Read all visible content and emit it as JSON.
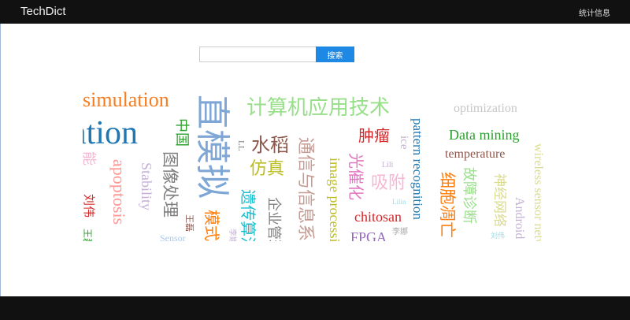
{
  "header": {
    "brand": "TechDict",
    "nav_stats": "统计信息"
  },
  "search": {
    "value": "",
    "placeholder": "",
    "button_label": "搜索"
  },
  "word_cloud": {
    "words": [
      {
        "text": "simulation",
        "color": "#f57c1f"
      },
      {
        "text": "ation",
        "color": "#1f77b4"
      },
      {
        "text": "直模拟",
        "color": "#7fa7d6"
      },
      {
        "text": "计算机应用技术",
        "color": "#98df8a"
      },
      {
        "text": "optimization",
        "color": "#c7c7c7"
      },
      {
        "text": "中国",
        "color": "#2ca02c"
      },
      {
        "text": "水稻",
        "color": "#8c564b"
      },
      {
        "text": "肿瘤",
        "color": "#d62728"
      },
      {
        "text": "pattern recognition",
        "color": "#1f77b4"
      },
      {
        "text": "Data mining",
        "color": "#2ca02c"
      },
      {
        "text": "temperature",
        "color": "#8c564b"
      },
      {
        "text": "wireless sensor networks",
        "color": "#dbdb8d"
      },
      {
        "text": "能",
        "color": "#f7b6d2"
      },
      {
        "text": "apoptosis",
        "color": "#ff9896"
      },
      {
        "text": "Stability",
        "color": "#c5b0d5"
      },
      {
        "text": "图像处理",
        "color": "#7f7f7f"
      },
      {
        "text": "仿真",
        "color": "#bcbd22"
      },
      {
        "text": "通信与信息系统",
        "color": "#c49c94"
      },
      {
        "text": "image processing",
        "color": "#bcbd22"
      },
      {
        "text": "光催化",
        "color": "#e377c2"
      },
      {
        "text": "吸附",
        "color": "#f7b6d2"
      },
      {
        "text": "ice",
        "color": "#c5b0d5"
      },
      {
        "text": "细胞凋亡",
        "color": "#ff7f0e"
      },
      {
        "text": "故障诊断",
        "color": "#98df8a"
      },
      {
        "text": "神经网络",
        "color": "#dbdb8d"
      },
      {
        "text": "Android",
        "color": "#c5b0d5"
      },
      {
        "text": "遗传算法",
        "color": "#17becf"
      },
      {
        "text": "企业管理",
        "color": "#7f7f7f"
      },
      {
        "text": "模式",
        "color": "#ff7f0e"
      },
      {
        "text": "chitosan",
        "color": "#d62728"
      },
      {
        "text": "FPGA",
        "color": "#9467bd"
      },
      {
        "text": "Sensor",
        "color": "#aec7e8"
      },
      {
        "text": "王磊",
        "color": "#8c564b"
      },
      {
        "text": "李娜",
        "color": "#aaaaaa"
      },
      {
        "text": "刘伟",
        "color": "#9edae5"
      },
      {
        "text": "Lili",
        "color": "#c5b0d5"
      },
      {
        "text": "Lilin",
        "color": "#9edae5"
      },
      {
        "text": "刘伟",
        "color": "#d62728"
      },
      {
        "text": "LL",
        "color": "#7f7f7f"
      },
      {
        "text": "李娜",
        "color": "#c5b0d5"
      },
      {
        "text": "王磊",
        "color": "#2ca02c"
      }
    ]
  }
}
